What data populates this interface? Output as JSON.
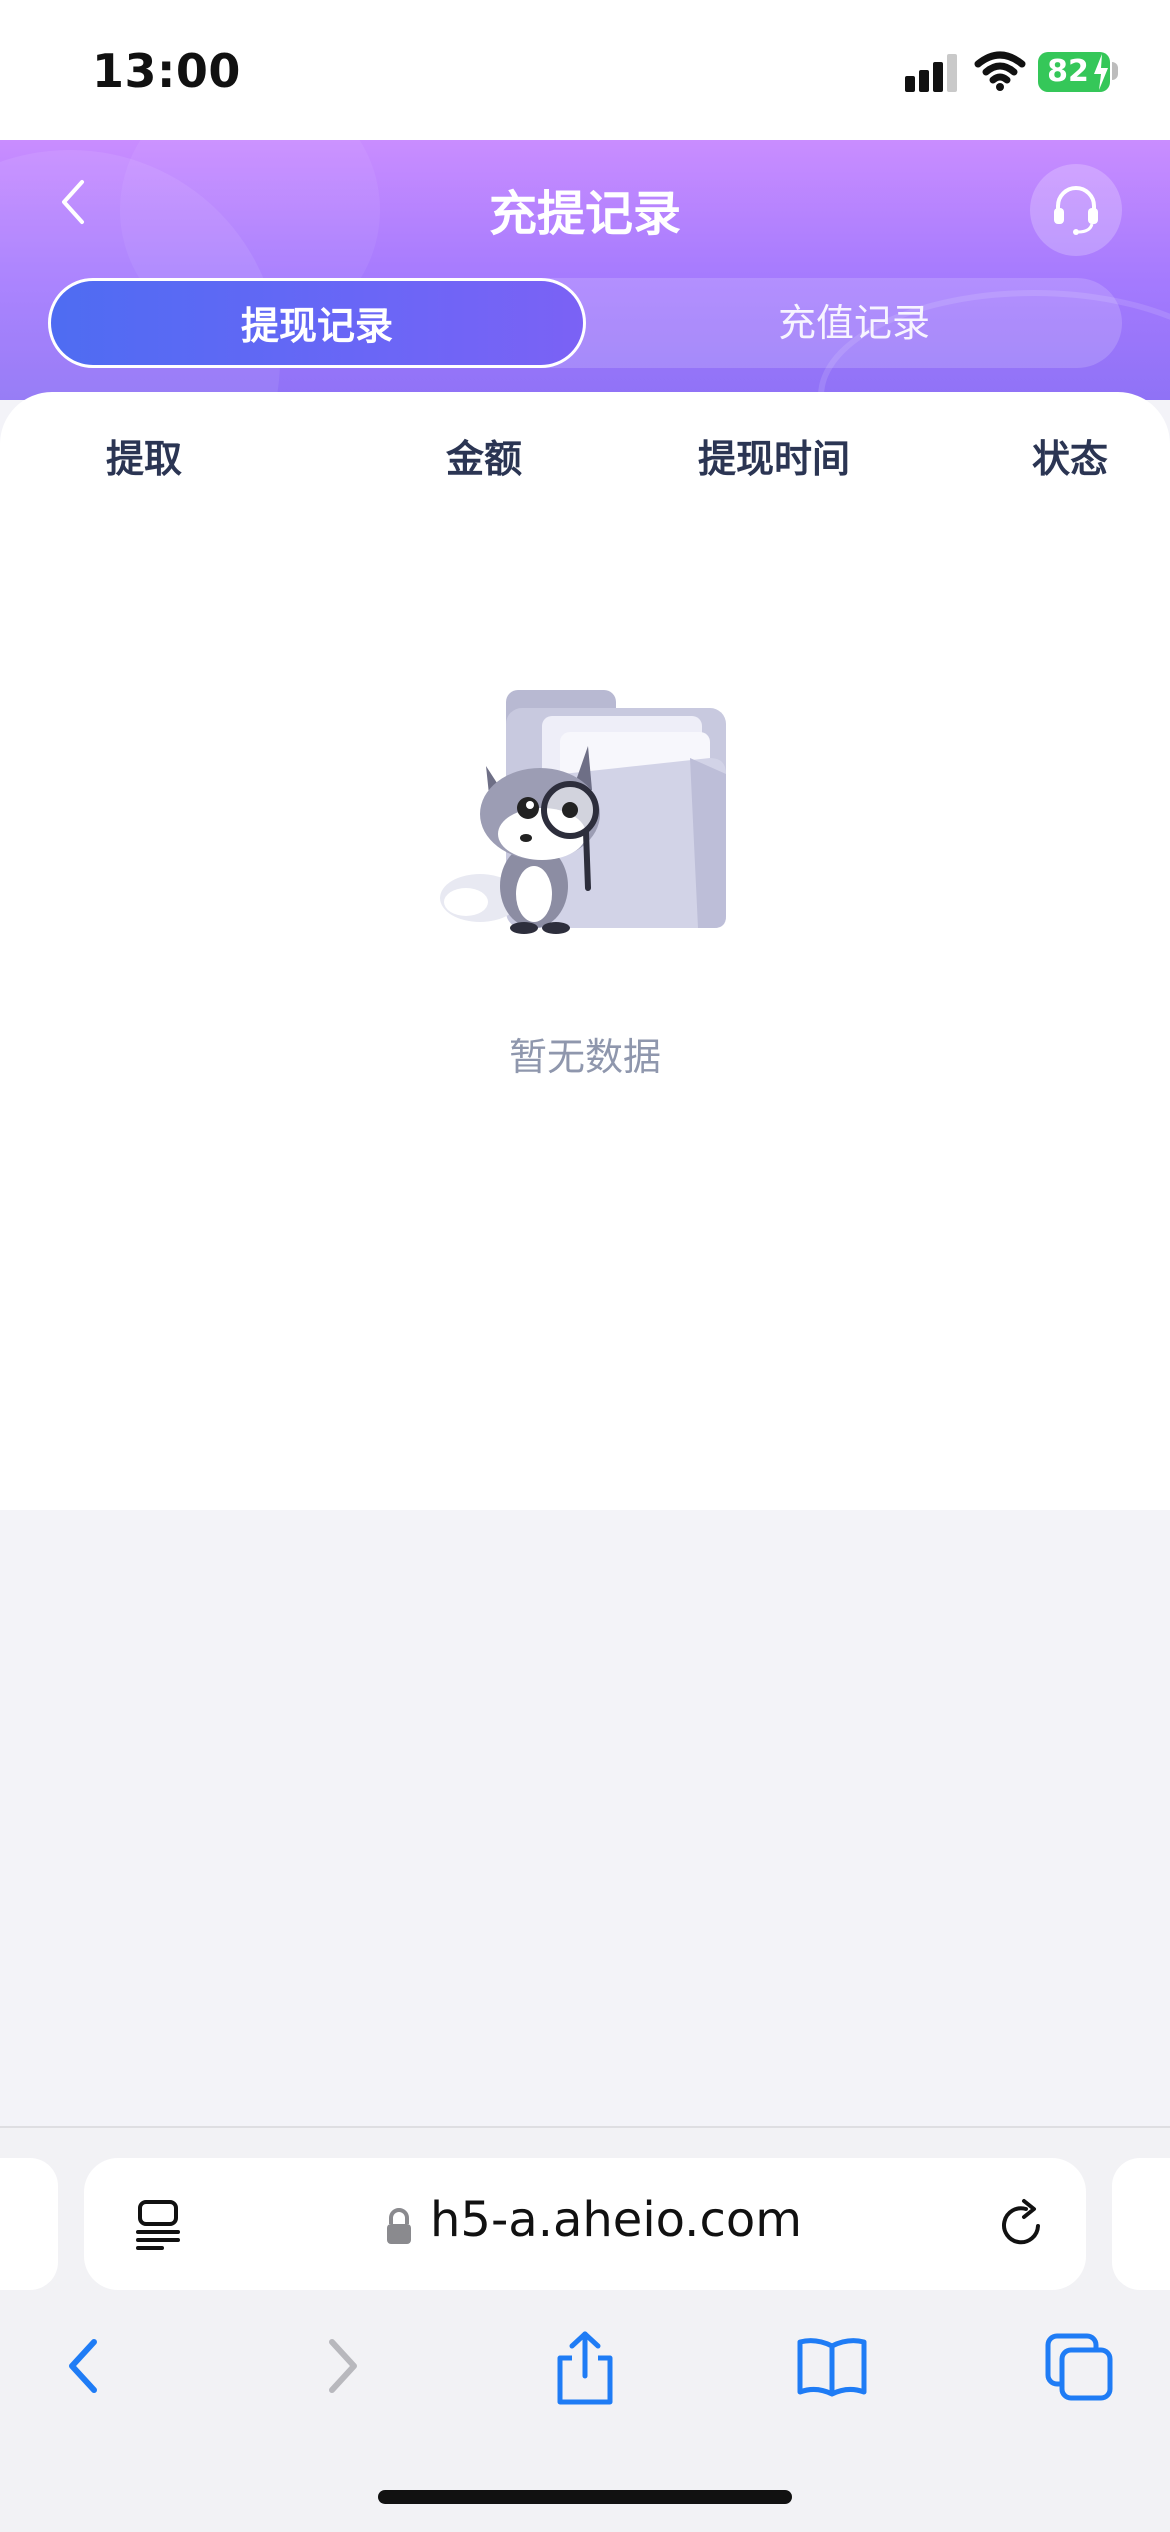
{
  "status_bar": {
    "time": "13:00",
    "battery": "82"
  },
  "header": {
    "title": "充提记录",
    "back_icon": "chevron-left-icon",
    "support_icon": "headset-icon",
    "tabs": [
      {
        "label": "提现记录",
        "active": true
      },
      {
        "label": "充值记录",
        "active": false
      }
    ]
  },
  "table": {
    "columns": [
      "提取",
      "金额",
      "提现时间",
      "状态"
    ],
    "rows": []
  },
  "empty_state": {
    "text": "暂无数据",
    "illustration": "fox-with-magnifier-and-folder"
  },
  "browser": {
    "url": "h5-a.aheio.com",
    "icons": [
      "reader-icon",
      "lock-icon",
      "reload-icon",
      "back-icon",
      "forward-icon",
      "share-icon",
      "bookmarks-icon",
      "tabs-icon"
    ]
  },
  "colors": {
    "header_gradient_top": "#c98dff",
    "header_gradient_bottom": "#8f72f6",
    "active_tab": "#5b68f3",
    "column_text": "#2b3553",
    "empty_text": "#8f97ad",
    "link_blue": "#1f7cf5"
  }
}
